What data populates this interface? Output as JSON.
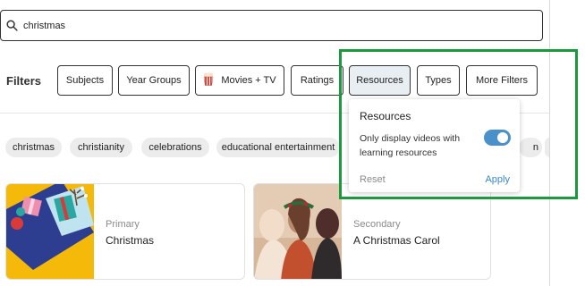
{
  "search": {
    "value": "christmas",
    "icon": "search-icon"
  },
  "filters": {
    "label": "Filters",
    "buttons": [
      "Subjects",
      "Year Groups",
      "Movies + TV",
      "Ratings",
      "Resources",
      "Types",
      "More Filters"
    ],
    "active": "Resources",
    "movies_icon": "popcorn-icon"
  },
  "tags": [
    "christmas",
    "christianity",
    "celebrations",
    "educational entertainment",
    "n"
  ],
  "popover": {
    "title": "Resources",
    "description": "Only display videos with learning resources",
    "toggle_on": true,
    "toggle_color": "#4a90c9",
    "reset_label": "Reset",
    "apply_label": "Apply"
  },
  "results": [
    {
      "level": "Primary",
      "title": "Christmas"
    },
    {
      "level": "Secondary",
      "title": "A Christmas Carol"
    }
  ],
  "colors": {
    "highlight": "#1a9a3c",
    "accent": "#3a87c5"
  }
}
